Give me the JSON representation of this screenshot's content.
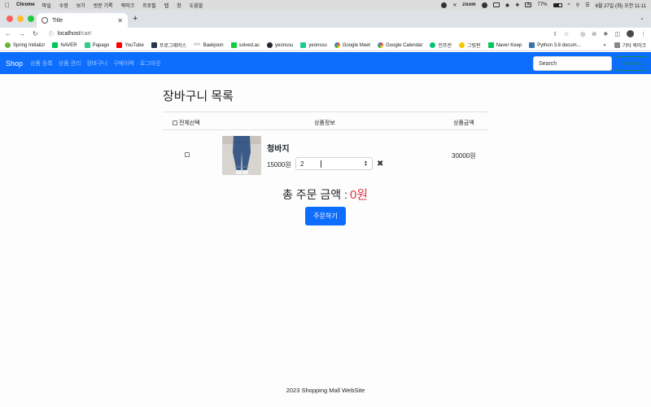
{
  "os_menubar": {
    "app_name": "Chrome",
    "items": [
      "파일",
      "수정",
      "보기",
      "방문 기록",
      "북마크",
      "프로필",
      "탭",
      "창",
      "도움말"
    ],
    "zoom_label": "zoom",
    "input_indicator": "A",
    "battery_percent": "77%",
    "clock": "6월 27일 (화) 오전 11:11"
  },
  "browser": {
    "tab_title": "Title",
    "url_host": "localhost",
    "url_path": "/cart",
    "bookmarks": [
      {
        "label": "Spring Initializr",
        "color": "#6db33f"
      },
      {
        "label": "NAVER",
        "color": "#03c75a"
      },
      {
        "label": "Papago",
        "color": "#2fcc8b"
      },
      {
        "label": "YouTube",
        "color": "#ff0000"
      },
      {
        "label": "프로그래머스",
        "color": "#263747"
      },
      {
        "label": "Baekjoon",
        "color": "#ffffff"
      },
      {
        "label": "solved.ac",
        "color": "#17ce3a"
      },
      {
        "label": "yeonssu",
        "color": "#24292f"
      },
      {
        "label": "yeonssu",
        "color": "#20c997"
      },
      {
        "label": "Google Meet",
        "color": "#00897b"
      },
      {
        "label": "Google Calendar",
        "color": "#4285f4"
      },
      {
        "label": "인프런",
        "color": "#00c471"
      },
      {
        "label": "그릿판",
        "color": "#f7c600"
      },
      {
        "label": "Naver Keep",
        "color": "#03c75a"
      },
      {
        "label": "Python 3.8 docum...",
        "color": "#3776ab"
      }
    ],
    "more_label": "»",
    "other_bookmarks": "기타 북마크"
  },
  "navbar": {
    "brand": "Shop",
    "links": [
      "상품 등록",
      "상품 관리",
      "장바구니",
      "구매이력",
      "로그아웃"
    ],
    "search_placeholder": "Search",
    "search_button": "Search",
    "color": "#0d6efd"
  },
  "cart": {
    "title": "장바구니 목록",
    "headers": {
      "select_all": "전체선택",
      "info": "상품정보",
      "price": "상품금액"
    },
    "items": [
      {
        "name": "청바지",
        "unit_price": "15000원",
        "quantity": "2",
        "item_total": "30000원",
        "checked": false
      }
    ],
    "total_label": "총 주문 금액 :",
    "total_amount": "0원",
    "order_button": "주문하기"
  },
  "footer": {
    "text": "2023 Shopping Mall WebSite"
  }
}
